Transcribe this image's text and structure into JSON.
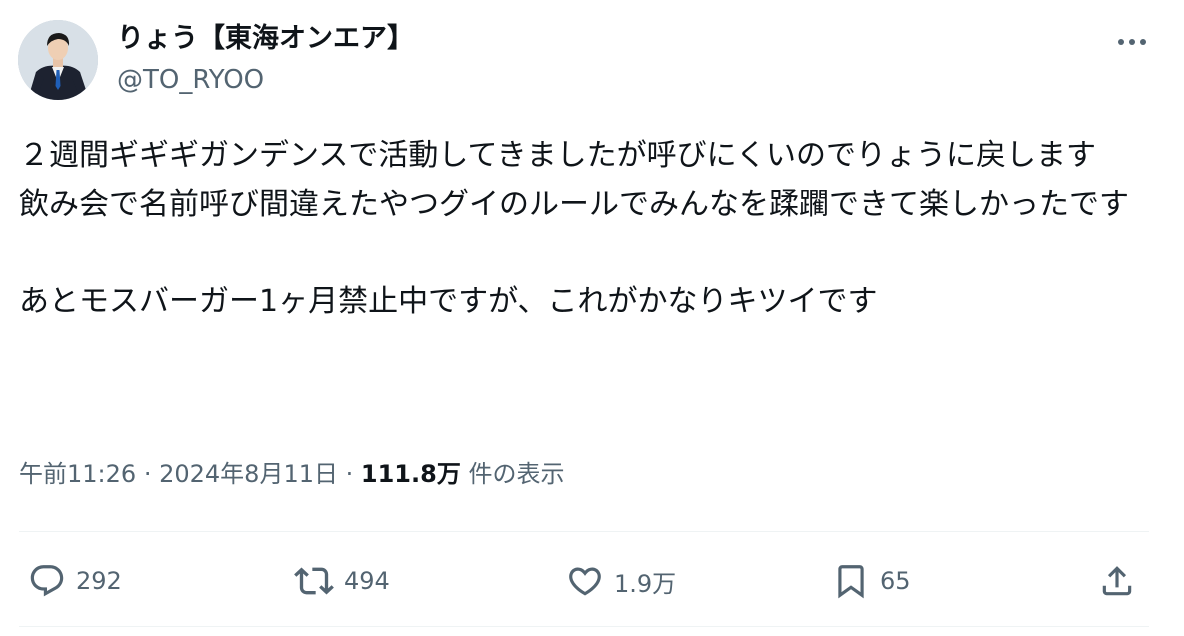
{
  "author": {
    "display_name": "りょう【東海オンエア】",
    "handle": "@TO_RYOO",
    "avatar_icon": "user-avatar"
  },
  "tweet": {
    "text": "２週間ギギギガンデンスで活動してきましたが呼びにくいのでりょうに戻します\n飲み会で名前呼び間違えたやつグイのルールでみんなを蹂躙できて楽しかったです\n\nあとモスバーガー1ヶ月禁止中ですが、これがかなりキツイです"
  },
  "meta": {
    "time": "午前11:26",
    "separator": "·",
    "date": "2024年8月11日",
    "views_count": "111.8万",
    "views_label": "件の表示"
  },
  "actions": {
    "replies": "292",
    "retweets": "494",
    "likes": "1.9万",
    "bookmarks": "65"
  },
  "colors": {
    "text": "#0f1419",
    "secondary": "#536471",
    "divider": "#eff3f4"
  }
}
